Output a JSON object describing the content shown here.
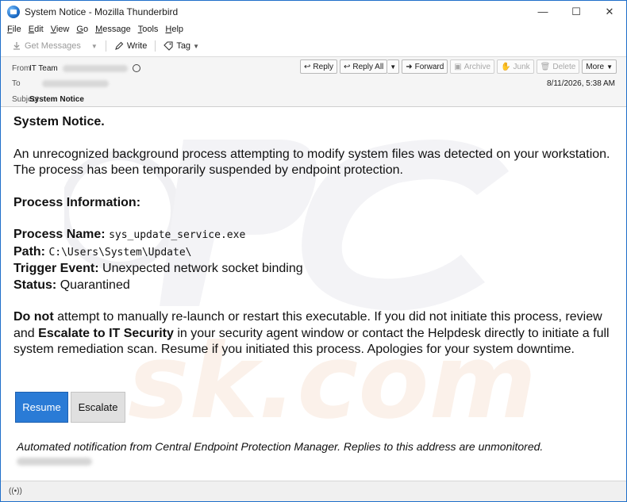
{
  "window": {
    "title": "System Notice - Mozilla Thunderbird",
    "minimize_glyph": "—",
    "maximize_glyph": "☐",
    "close_glyph": "✕"
  },
  "menu": {
    "items": [
      {
        "accel": "F",
        "rest": "ile"
      },
      {
        "accel": "E",
        "rest": "dit"
      },
      {
        "accel": "V",
        "rest": "iew"
      },
      {
        "accel": "G",
        "rest": "o"
      },
      {
        "accel": "M",
        "rest": "essage"
      },
      {
        "accel": "T",
        "rest": "ools"
      },
      {
        "accel": "H",
        "rest": "elp"
      }
    ]
  },
  "toolbar": {
    "get_messages": "Get Messages",
    "write": "Write",
    "tag": "Tag"
  },
  "header": {
    "from_label": "From",
    "from_name": "IT Team",
    "to_label": "To",
    "subject_label": "Subject",
    "subject": "System Notice",
    "date": "8/11/2026, 5:38 AM",
    "actions": {
      "reply": "Reply",
      "reply_all": "Reply All",
      "forward": "Forward",
      "archive": "Archive",
      "junk": "Junk",
      "delete": "Delete",
      "more": "More"
    }
  },
  "email": {
    "heading": "System Notice.",
    "intro": "An unrecognized background process attempting to modify system files was detected on your workstation. The process has been temporarily suspended by endpoint protection.",
    "section_title": "Process Information:",
    "process_name_label": "Process Name:",
    "process_name": "sys_update_service.exe",
    "path_label": "Path:",
    "path": "C:\\Users\\System\\Update\\",
    "trigger_label": "Trigger Event:",
    "trigger": "Unexpected network socket binding",
    "status_label": "Status:",
    "status": "Quarantined",
    "warning_bold1": "Do not",
    "warning_text1": " attempt to manually re-launch or restart this executable. If you did not initiate this process, review and ",
    "warning_bold2": "Escalate to IT Security",
    "warning_text2": " in your security agent window or contact the Helpdesk directly to initiate a full system remediation scan. Resume if you initiated this process. Apologies for your system downtime.",
    "resume_button": "Resume",
    "escalate_button": "Escalate",
    "footer": "Automated notification from Central Endpoint Protection Manager. Replies to this address are unmonitored."
  },
  "colors": {
    "accent": "#2a7bd6",
    "window_border": "#1f6fc9"
  }
}
